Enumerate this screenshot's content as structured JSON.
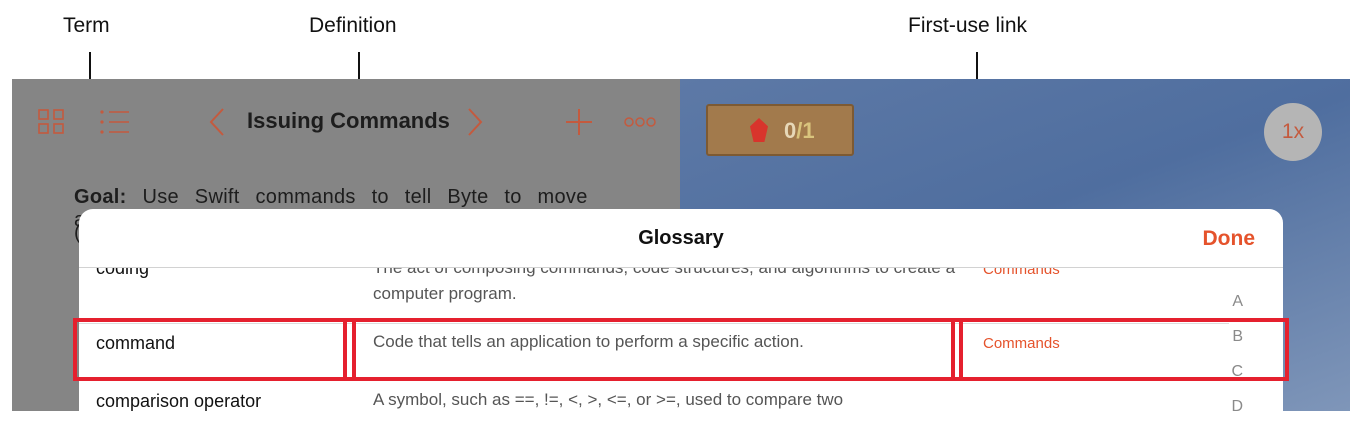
{
  "callouts": {
    "term": "Term",
    "definition": "Definition",
    "first_use": "First-use link"
  },
  "toolbar": {
    "title": "Issuing Commands",
    "icons": [
      "grid-icon",
      "list-icon",
      "chevron-left-icon",
      "chevron-right-icon",
      "plus-icon",
      "more-icon"
    ]
  },
  "goal": {
    "label": "Goal:",
    "text": "Use Swift commands to tell Byte to move and"
  },
  "scene": {
    "gem_count": "0",
    "gem_total": "/1",
    "speed": "1x"
  },
  "glossary": {
    "title": "Glossary",
    "done": "Done",
    "rows": [
      {
        "term": "coding",
        "definition": "The act of composing commands, code structures, and algorithms to create a computer program.",
        "link": "Commands"
      },
      {
        "term": "command",
        "definition": "Code that tells an application to perform a specific action.",
        "link": "Commands"
      },
      {
        "term": "comparison operator",
        "definition": "A symbol, such as ==,  !=, <, >, <=, or >=, used to compare two",
        "link": ""
      }
    ],
    "index": [
      "A",
      "B",
      "C",
      "D"
    ]
  },
  "colors": {
    "accent": "#e5532c",
    "highlight": "#e5202e"
  }
}
